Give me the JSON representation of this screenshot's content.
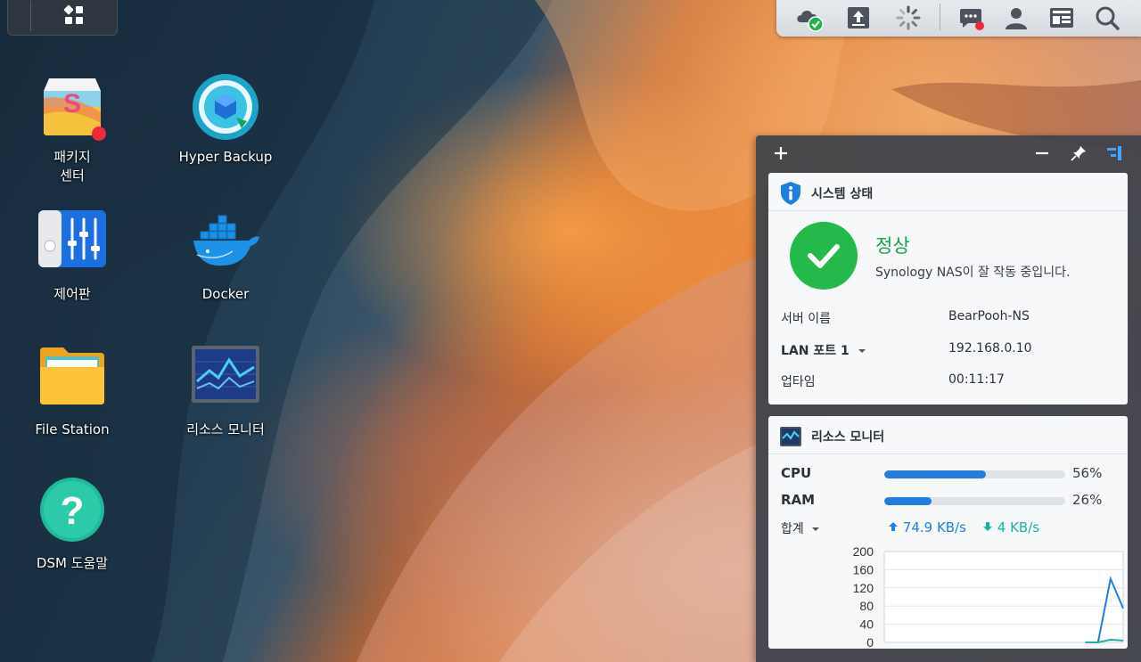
{
  "desktop": {
    "icons": [
      {
        "label": "패키지\n센터",
        "icon": "package-center-icon"
      },
      {
        "label": "Hyper Backup",
        "icon": "hyper-backup-icon"
      },
      {
        "label": "제어판",
        "icon": "control-panel-icon"
      },
      {
        "label": "Docker",
        "icon": "docker-icon"
      },
      {
        "label": "File Station",
        "icon": "file-station-icon"
      },
      {
        "label": "리소스 모니터",
        "icon": "resource-monitor-icon"
      },
      {
        "label": "DSM 도움말",
        "icon": "dsm-help-icon"
      }
    ]
  },
  "taskbar": {
    "icons": [
      "cloud-sync-ok-icon",
      "upload-icon",
      "loading-spinner-icon",
      "notification-chat-icon",
      "user-icon",
      "widget-card-icon",
      "search-icon"
    ]
  },
  "panel": {
    "header_icons": [
      "add-icon",
      "minimize-icon",
      "pin-icon",
      "panel-toggle-icon"
    ],
    "system_status": {
      "title": "시스템 상태",
      "state": "정상",
      "message": "Synology NAS이 잘 작동 중입니다.",
      "server_name_label": "서버 이름",
      "server_name_value": "BearPooh-NS",
      "lan_label": "LAN 포트 1",
      "lan_value": "192.168.0.10",
      "uptime_label": "업타임",
      "uptime_value": "00:11:17"
    },
    "resource_monitor": {
      "title": "리소스 모니터",
      "cpu_label": "CPU",
      "cpu_percent": 56,
      "cpu_text": "56%",
      "ram_label": "RAM",
      "ram_percent": 26,
      "ram_text": "26%",
      "total_label": "합계",
      "upload": "74.9 KB/s",
      "download": "4 KB/s",
      "colors": {
        "upload": "#1e7fdf",
        "download": "#17b3a3",
        "bar": "#1e7fdf"
      }
    }
  },
  "chart_data": {
    "type": "line",
    "yticks": [
      "200",
      "160",
      "120",
      "80",
      "40",
      "0"
    ],
    "ylim": [
      0,
      200
    ],
    "x": [
      0,
      1,
      2,
      3,
      4,
      5,
      6,
      7,
      8,
      9,
      10,
      11,
      12,
      13,
      14,
      15,
      16,
      17,
      18,
      19
    ],
    "series": [
      {
        "values": [
          null,
          null,
          null,
          null,
          null,
          null,
          null,
          null,
          null,
          null,
          null,
          null,
          null,
          null,
          null,
          null,
          0,
          0,
          140,
          75
        ]
      },
      {
        "values": [
          null,
          null,
          null,
          null,
          null,
          null,
          null,
          null,
          null,
          null,
          null,
          null,
          null,
          null,
          null,
          null,
          0,
          0,
          6,
          4
        ]
      }
    ]
  }
}
